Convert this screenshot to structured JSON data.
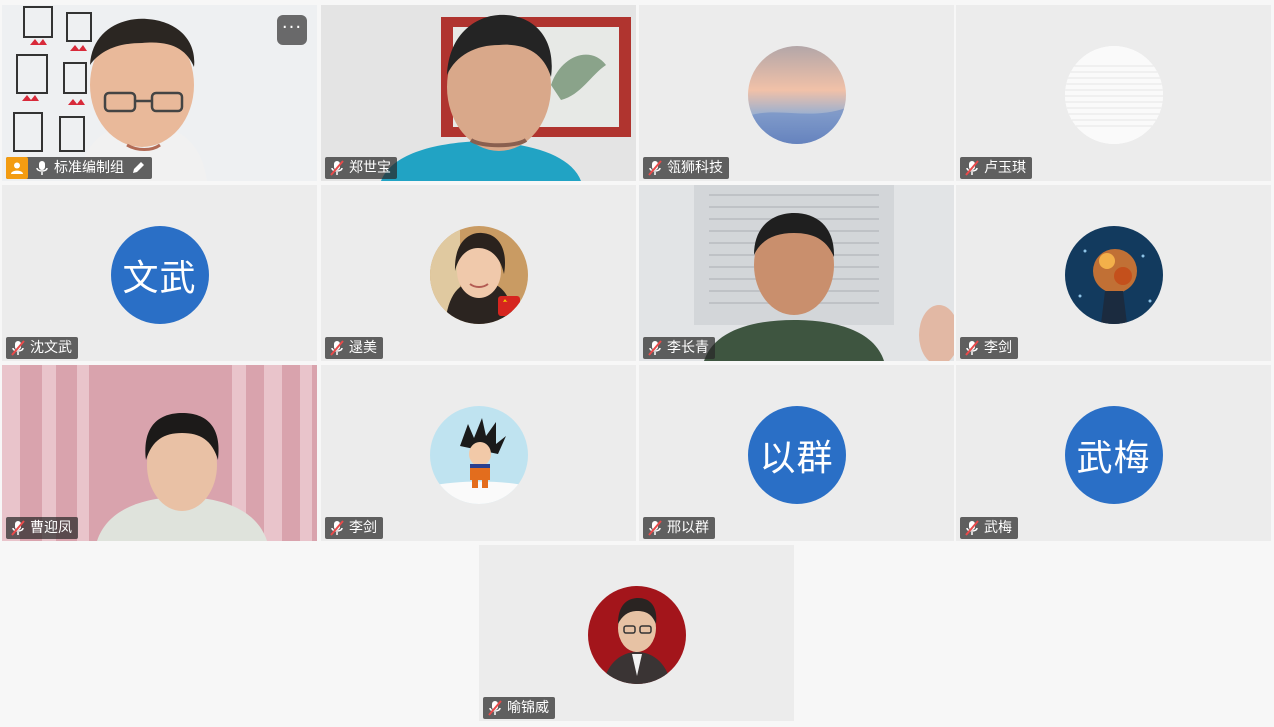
{
  "participants": [
    {
      "name": "标准编制组",
      "host": true
    },
    {
      "name": "郑世宝"
    },
    {
      "name": "瓴狮科技"
    },
    {
      "name": "卢玉琪"
    },
    {
      "name": "沈文武",
      "avatar_text": "文武"
    },
    {
      "name": "逯美"
    },
    {
      "name": "李长青"
    },
    {
      "name": "李剑"
    },
    {
      "name": "曹迎凤"
    },
    {
      "name": "李剑"
    },
    {
      "name": "邢以群",
      "avatar_text": "以群"
    },
    {
      "name": "武梅",
      "avatar_text": "武梅"
    },
    {
      "name": "喻锦威"
    }
  ],
  "more_button": "···",
  "colors": {
    "avatar_blue": "#2a6fc6",
    "host_badge": "#f39c12",
    "tile_bg": "#ececec"
  },
  "icons": {
    "mic": "mic-muted-icon",
    "host": "person-icon",
    "edit": "pencil-icon",
    "more": "more-icon"
  }
}
